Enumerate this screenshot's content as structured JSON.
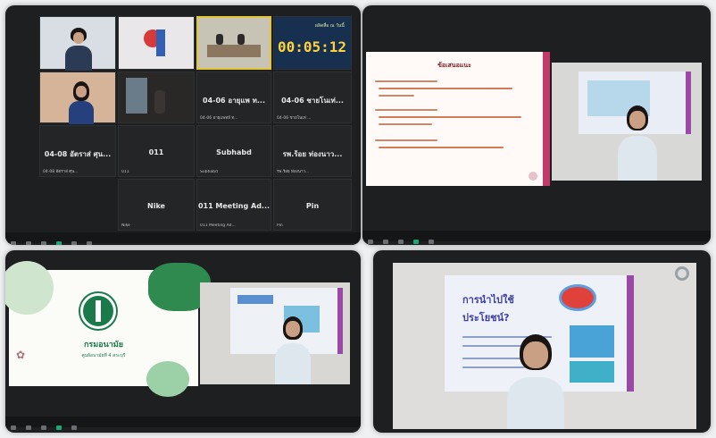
{
  "timer": "00:05:12",
  "timer_caption": "ผลิตสื่อ ณ วันนี้",
  "grid_tiles": [
    {
      "name": "04-06 อายุแพ ท...",
      "caption": "04-06 อายุแพทย์ ท..."
    },
    {
      "name": "04-06 ชายโนเท่...",
      "caption": "04-06 ชายโนเท่ ..."
    },
    {
      "name": "04-08 อัตราส่ ศุน...",
      "caption": "04-08 อัตราส่ ศุน..."
    },
    {
      "name": "011",
      "caption": "011"
    },
    {
      "name": "Subhabd",
      "caption": "Subhabd"
    },
    {
      "name": "รพ.ร้อย ท่องนาว...",
      "caption": "รพ.ร้อย ท่องนาว..."
    },
    {
      "name": "Nike",
      "caption": "Nike"
    },
    {
      "name": "011 Meeting Ad...",
      "caption": "011 Meeting Ad..."
    },
    {
      "name": "Pin",
      "caption": "Pin"
    }
  ],
  "slide_tr_title": "ข้อเสนอแนะ",
  "slide_br_title_1": "การนำไปใช้",
  "slide_br_title_2": "ประโยชน์?",
  "logo_text": "กรมอนามัย",
  "logo_sub": "ศูนย์อนามัยที่ 4 สระบุรี"
}
